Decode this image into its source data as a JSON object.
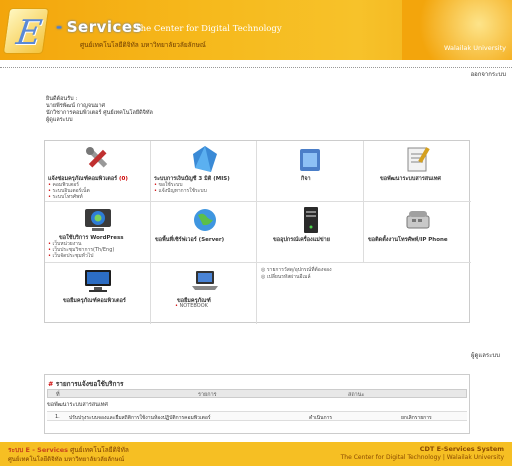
{
  "header": {
    "logo_letter": "E",
    "brand": "Services",
    "brand_dash": "-",
    "tagline": "The Center for Digital Technology",
    "org_thai": "ศูนย์เทคโนโลยีดิจิทัล มหาวิทยาลัยวลัยลักษณ์",
    "university": "Walailak University"
  },
  "logout": "ออกจากระบบ",
  "welcome": {
    "greeting": "ยินดีต้อนรับ :",
    "name": "นายพีรพัฒน์ กาญจนมาศ",
    "position": "นักวิชาการคอมพิวเตอร์ ศูนย์เทคโนโลยีดิจิทัล",
    "role": "ผู้ดูแลระบบ"
  },
  "services": [
    {
      "title": "แจ้งซ่อมครุภัณฑ์คอมพิวเตอร์",
      "badge": "(0)",
      "items": [
        "คอมพิวเตอร์",
        "ระบบอินเตอร์เน็ต",
        "ระบบโทรศัพท์"
      ],
      "icon": "tools-icon"
    },
    {
      "title": "ระบบการเงินบัญชี 3 มิติ (MIS)",
      "items": [
        "ขอใช้ระบบ",
        "แจ้งปัญหาการใช้ระบบ"
      ],
      "icon": "mis-icon"
    },
    {
      "title": "กิจา",
      "items": [],
      "icon": "folder-icon"
    },
    {
      "title": "ขอพัฒนาระบบสารสนเทศ",
      "items": [],
      "icon": "notepad-icon"
    },
    {
      "title": "ขอใช้บริการ WordPress",
      "items": [
        "เว็บหน่วยงาน",
        "เว็บประชุมวิชาการ(Th/Eng)",
        "เว็บจัดประชุมทั่วไป"
      ],
      "icon": "wordpress-icon"
    },
    {
      "title": "ขอพื้นที่เซิร์ฟเวอร์ (Server)",
      "items": [],
      "icon": "globe-icon"
    },
    {
      "title": "ขออุปกรณ์เครื่องแม่ข่าย",
      "items": [],
      "icon": "server-icon"
    },
    {
      "title": "ขอติดตั้งงานโทรศัพท์/IP Phone",
      "items": [],
      "icon": "phone-icon"
    },
    {
      "title": "ขอยืมครุภัณฑ์คอมพิวเตอร์",
      "items": [],
      "icon": "desktop-icon"
    },
    {
      "title": "ขอยืมครุภัณฑ์",
      "items": [
        "NOTEBOOK"
      ],
      "icon": "laptop-icon"
    }
  ],
  "links": [
    "รายการวัสดุ/อุปกรณ์ที่ต้องจอง",
    "เปลี่ยนรหัสผ่านอีเมล์"
  ],
  "section_users": "ผู้ดูแลระบบ",
  "report": {
    "hash": "#",
    "title": "รายการแจ้งขอใช้บริการ",
    "col_no": "ที่",
    "col_item": "รายการ",
    "col_status": "สถานะ",
    "group": "ขอพัฒนาระบบสารสนเทศ",
    "row_no": "1.",
    "row_item": "ปรับปรุงระบบจองและยืมสถิติการใช้งานห้องปฏิบัติการคอมพิวเตอร์",
    "row_status": "ดำเนินการ",
    "row_action": "ยกเลิกรายการ"
  },
  "footer": {
    "left_prefix": "ระบบ E - Services",
    "left_suffix": "ศูนย์เทคโนโลยีดิจิทัล",
    "left_line2": "ศูนย์เทคโนโลยีดิจิทัล มหาวิทยาลัยวลัยลักษณ์",
    "right_line1": "CDT E-Services System",
    "right_line2": "The Center for Digital Technology | Walailak University"
  }
}
